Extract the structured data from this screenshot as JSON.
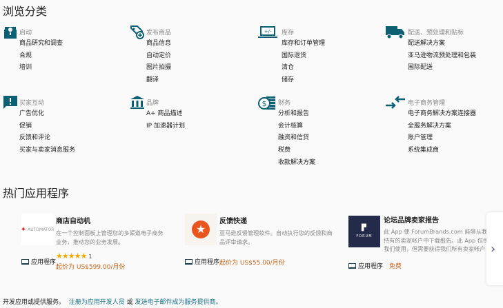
{
  "browse": {
    "title": "浏览分类",
    "categories": [
      {
        "icon": "toolbox-icon",
        "head": "启动",
        "items": [
          "商品研究和调查",
          "合规",
          "培训"
        ]
      },
      {
        "icon": "tag-plus-icon",
        "head": "发布商品",
        "items": [
          "商品信息",
          "自动定价",
          "图片拍摄",
          "翻译"
        ]
      },
      {
        "icon": "laptop-plus-minus-icon",
        "head": "库存",
        "items": [
          "库存和订单管理",
          "国际退货",
          "清仓",
          "储存"
        ]
      },
      {
        "icon": "truck-icon",
        "head": "配送、预处理和贴标",
        "items": [
          "配送解决方案",
          "亚马逊物流预处理和包装",
          "国际配送"
        ]
      },
      {
        "icon": "chat-alert-icon",
        "head": "买家互动",
        "items": [
          "广告优化",
          "促销",
          "反馈和评论",
          "买家与卖家消息服务"
        ]
      },
      {
        "icon": "bank-icon",
        "head": "品牌",
        "items": [
          "A+ 商品描述",
          "IP 加速器计划"
        ]
      },
      {
        "icon": "dollar-coins-icon",
        "head": "财务",
        "items": [
          "分析和报告",
          "会计核算",
          "融资和信贷",
          "税费",
          "收款解决方案"
        ]
      },
      {
        "icon": "arrows-exchange-icon",
        "head": "电子商务管理",
        "items": [
          "电子商务解决方案连接器",
          "全服务解决方案",
          "账户管理",
          "系统集成商"
        ]
      }
    ]
  },
  "apps": {
    "title": "热门应用程序",
    "cards": [
      {
        "title": "商店自动机",
        "logo_text": "store AUTOMATOR",
        "desc": "在一个控制面板上管理您的多渠道电子商务业务，推动您的业务发展。",
        "type": "应用程序",
        "rating": 5,
        "rating_count": "1",
        "price": "起价为 US$599.00/月份"
      },
      {
        "title": "反馈快递",
        "desc": "亚马逊反馈管理软件。自动执行您的反馈和商品评审请求。",
        "type": "应用程序",
        "price": "起价为 US$55.00/月份"
      },
      {
        "title": "论坛品牌卖家报告",
        "logo_text": "FORUM",
        "desc": "此 App 使 ForumBrands.com 能够从我们持有的卖家帐户中下载报告。此 App 仅供我们使用，但需要获得我们所有卖家帐户的…",
        "type": "应用程序",
        "price": "免费"
      }
    ]
  },
  "footer": {
    "text": "开发应用或提供服务。",
    "link1": "注册为应用开发人员",
    "or": "或",
    "link2": "发送电子邮件成为服务提供商。"
  },
  "colors": {
    "teal": "#0d5f73",
    "price": "#c7651c",
    "link": "#1a6f8a"
  }
}
